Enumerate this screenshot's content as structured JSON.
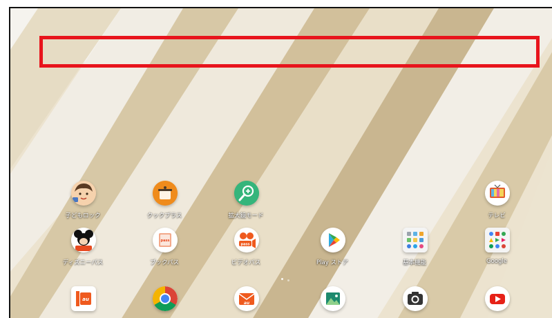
{
  "home_screen": {
    "apps": [
      {
        "id": "kids-lock",
        "label": "子どもロック",
        "icon": "child-face-icon"
      },
      {
        "id": "cook-plus",
        "label": "クックプラス",
        "icon": "cooking-pot-icon"
      },
      {
        "id": "magnifier",
        "label": "拡大鏡モード",
        "icon": "magnifier-icon"
      },
      {
        "id": "tv",
        "label": "テレビ",
        "icon": "tv-icon"
      },
      {
        "id": "disney-pass",
        "label": "ディズニーパス",
        "icon": "mickey-icon",
        "badge": "pass"
      },
      {
        "id": "book-pass",
        "label": "ブックパス",
        "icon": "book-pass-icon",
        "badge": "pass"
      },
      {
        "id": "video-pass",
        "label": "ビデオパス",
        "icon": "video-pass-icon",
        "badge": "pass"
      },
      {
        "id": "play-store",
        "label": "Play ストア",
        "icon": "play-store-icon"
      },
      {
        "id": "basic-functions",
        "label": "基本機能",
        "icon": "folder-icon"
      },
      {
        "id": "google",
        "label": "Google",
        "icon": "google-folder-icon"
      }
    ],
    "dock": [
      {
        "id": "au",
        "icon": "au-icon",
        "text": "au"
      },
      {
        "id": "chrome",
        "icon": "chrome-icon"
      },
      {
        "id": "au-mail",
        "icon": "mail-icon",
        "text": "au"
      },
      {
        "id": "gallery",
        "icon": "gallery-icon"
      },
      {
        "id": "camera",
        "icon": "camera-icon"
      },
      {
        "id": "youtube",
        "icon": "youtube-icon"
      }
    ]
  },
  "highlight_color": "#e8141c"
}
